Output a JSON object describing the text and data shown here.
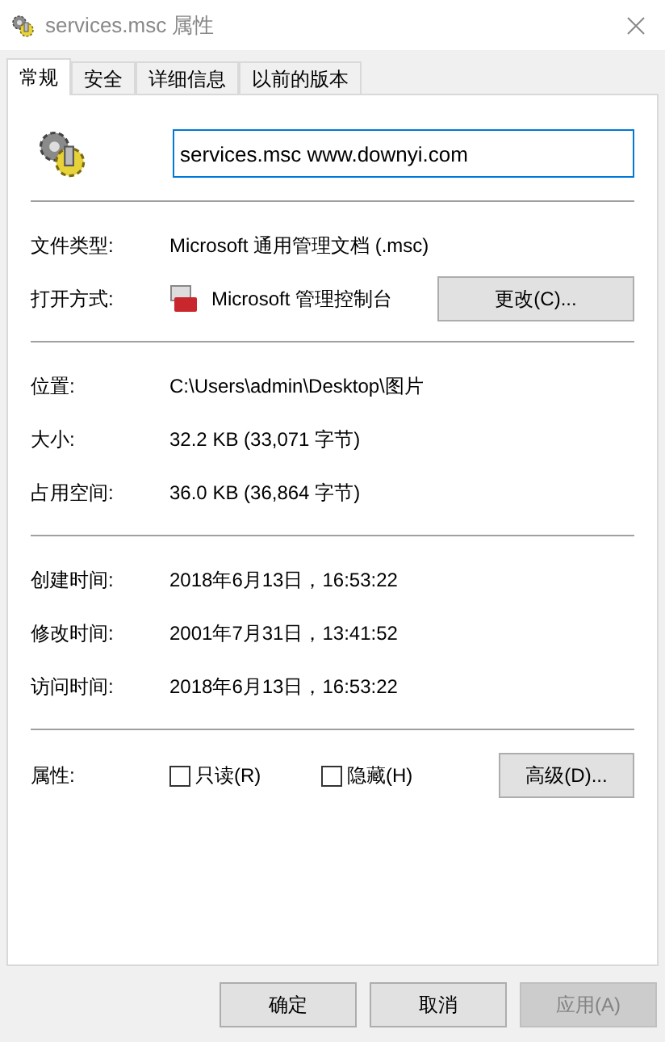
{
  "window": {
    "title": "services.msc 属性"
  },
  "tabs": [
    {
      "label": "常规",
      "selected": true
    },
    {
      "label": "安全",
      "selected": false
    },
    {
      "label": "详细信息",
      "selected": false
    },
    {
      "label": "以前的版本",
      "selected": false
    }
  ],
  "name_field": {
    "value": "services.msc www.downyi.com"
  },
  "sections": [
    {
      "rows": [
        {
          "kind": "text",
          "label": "文件类型:",
          "value": "Microsoft 通用管理文档 (.msc)"
        },
        {
          "kind": "app",
          "label": "打开方式:",
          "value": "Microsoft 管理控制台",
          "button": "更改(C)..."
        }
      ]
    },
    {
      "rows": [
        {
          "kind": "text",
          "label": "位置:",
          "value": "C:\\Users\\admin\\Desktop\\图片"
        },
        {
          "kind": "text",
          "label": "大小:",
          "value": "32.2 KB (33,071 字节)"
        },
        {
          "kind": "text",
          "label": "占用空间:",
          "value": "36.0 KB (36,864 字节)"
        }
      ]
    },
    {
      "rows": [
        {
          "kind": "text",
          "label": "创建时间:",
          "value": "2018年6月13日，16:53:22"
        },
        {
          "kind": "text",
          "label": "修改时间:",
          "value": "2001年7月31日，13:41:52"
        },
        {
          "kind": "text",
          "label": "访问时间:",
          "value": "2018年6月13日，16:53:22"
        }
      ]
    }
  ],
  "attributes": {
    "label": "属性:",
    "checkboxes": [
      {
        "label": "只读(R)",
        "checked": false
      },
      {
        "label": "隐藏(H)",
        "checked": false
      }
    ],
    "button": "高级(D)..."
  },
  "buttons": [
    {
      "label": "确定",
      "disabled": false
    },
    {
      "label": "取消",
      "disabled": false
    },
    {
      "label": "应用(A)",
      "disabled": true
    }
  ]
}
